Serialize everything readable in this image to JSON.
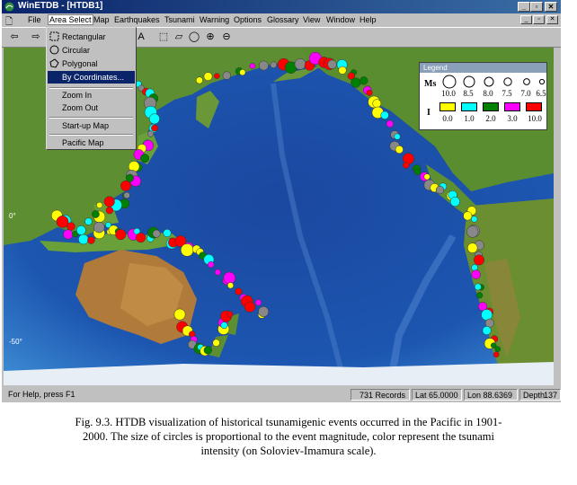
{
  "window": {
    "title": "WinETDB - [HTDB1]",
    "caption_buttons": [
      "_",
      "▫",
      "✕"
    ],
    "mdi_buttons": [
      "_",
      "▫",
      "✕"
    ]
  },
  "menubar": {
    "items": [
      "File",
      "Area Select",
      "Map",
      "Earthquakes",
      "Tsunami",
      "Warning",
      "Options",
      "Glossary",
      "View",
      "Window",
      "Help"
    ]
  },
  "area_select_menu": {
    "items": [
      {
        "label": "Rectangular",
        "icon": "rectangle-select-icon"
      },
      {
        "label": "Circular",
        "icon": "circle-select-icon"
      },
      {
        "label": "Polygonal",
        "icon": "polygon-select-icon"
      },
      {
        "label": "By Coordinates...",
        "icon": "",
        "selected": true
      },
      {
        "label": "Zoom In",
        "icon": ""
      },
      {
        "label": "Zoom Out",
        "icon": ""
      },
      {
        "label": "Start-up Map",
        "icon": ""
      },
      {
        "label": "Pacific Map",
        "icon": ""
      }
    ]
  },
  "map": {
    "lat_labels": [
      "0°",
      "-50°"
    ],
    "colors": {
      "ocean": "#1d4d9e",
      "land": "#4f8a2e",
      "ice": "#e8eef5"
    }
  },
  "legend": {
    "title": "Legend",
    "ms_label": "Ms",
    "i_label": "I",
    "ms_values": [
      "10.0",
      "8.5",
      "8.0",
      "7.5",
      "7.0",
      "6.5"
    ],
    "i_values": [
      "0.0",
      "1.0",
      "2.0",
      "3.0",
      "10.0"
    ],
    "i_colors": [
      "#ffff00",
      "#00ffff",
      "#008000",
      "#ff00ff",
      "#ff0000"
    ]
  },
  "statusbar": {
    "help": "For Help, press F1",
    "records": "731 Records",
    "lat": "Lat  65.0000",
    "lon": "Lon  88.6369",
    "depth_label": "Depth",
    "depth_value": "137"
  },
  "caption": {
    "line1": "Fig. 9.3. HTDB visualization of historical tsunamigenic events occurred in the Pacific in 1901-",
    "line2": "2000. The size of circles is proportional to the event magnitude, color represent the tsunami",
    "line3": "intensity (on Soloviev-Imamura scale)."
  }
}
